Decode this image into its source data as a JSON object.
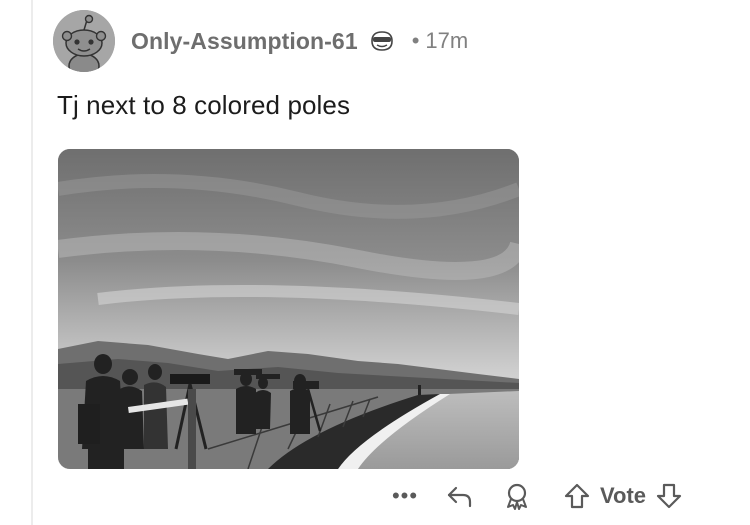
{
  "comment": {
    "username": "Only-Assumption-61",
    "time_separator": "•",
    "time": "17m",
    "body": "Tj next to 8 colored poles"
  },
  "media": {
    "type": "photo",
    "style": "grayscale"
  },
  "actions": {
    "more_label": "•••",
    "vote_label": "Vote",
    "icons": [
      "more-icon",
      "reply-icon",
      "award-icon",
      "upvote-icon",
      "downvote-icon"
    ]
  },
  "colors": {
    "username": "#6e6e6e",
    "meta": "#808080",
    "action": "#5a5a5a",
    "avatar_bg": "#a6a6a6"
  }
}
